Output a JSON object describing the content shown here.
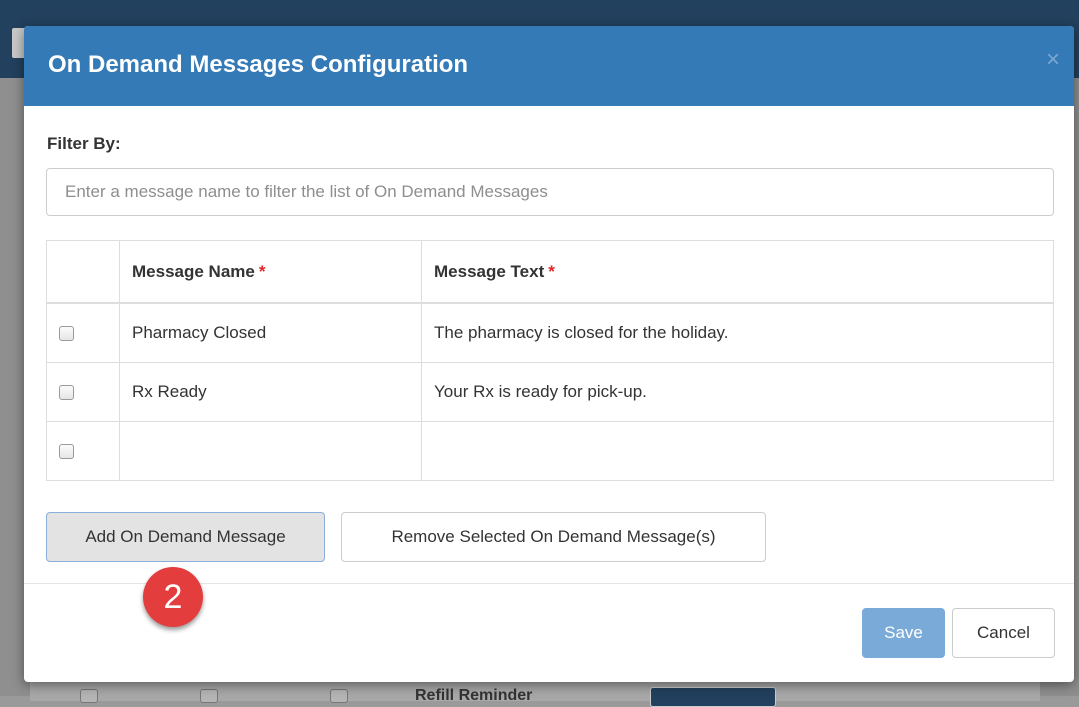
{
  "modal": {
    "title": "On Demand Messages Configuration",
    "close_glyph": "×"
  },
  "filter": {
    "label": "Filter By:",
    "placeholder": "Enter a message name to filter the list of On Demand Messages",
    "value": ""
  },
  "table": {
    "columns": [
      {
        "label": "Message Name",
        "required_mark": "*"
      },
      {
        "label": "Message Text",
        "required_mark": "*"
      }
    ],
    "rows": [
      {
        "checked": false,
        "name": "Pharmacy Closed",
        "text": "The pharmacy is closed for the holiday."
      },
      {
        "checked": false,
        "name": "Rx Ready",
        "text": "Your Rx is ready for pick-up."
      },
      {
        "checked": false,
        "name": "",
        "text": ""
      }
    ]
  },
  "actions": {
    "add_label": "Add On Demand Message",
    "remove_label": "Remove Selected On Demand Message(s)"
  },
  "step_marker": "2",
  "footer": {
    "save_label": "Save",
    "cancel_label": "Cancel"
  },
  "background": {
    "row_text": "Refill Reminder"
  },
  "colors": {
    "header": "#337ab7",
    "required": "#e0262a",
    "marker": "#e43d3d",
    "save_disabled": "#7aabd8"
  }
}
